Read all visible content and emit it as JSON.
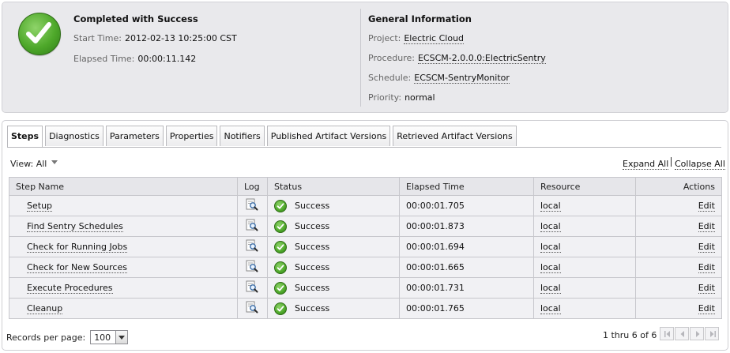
{
  "summary": {
    "status_title": "Completed with Success",
    "start_time_label": "Start Time:",
    "start_time": "2012-02-13 10:25:00 CST",
    "elapsed_label": "Elapsed Time:",
    "elapsed": "00:00:11.142"
  },
  "general": {
    "title": "General Information",
    "project_label": "Project:",
    "project": "Electric Cloud",
    "procedure_label": "Procedure:",
    "procedure": "ECSCM-2.0.0.0:ElectricSentry",
    "schedule_label": "Schedule:",
    "schedule": "ECSCM-SentryMonitor",
    "priority_label": "Priority:",
    "priority": "normal"
  },
  "tabs": [
    {
      "label": "Steps",
      "active": true
    },
    {
      "label": "Diagnostics"
    },
    {
      "label": "Parameters"
    },
    {
      "label": "Properties"
    },
    {
      "label": "Notifiers"
    },
    {
      "label": "Published Artifact Versions"
    },
    {
      "label": "Retrieved Artifact Versions"
    }
  ],
  "view": {
    "label": "View:",
    "value": "All"
  },
  "expand_all": "Expand All",
  "collapse_all": "Collapse All",
  "table": {
    "headers": [
      "Step Name",
      "Log",
      "Status",
      "Elapsed Time",
      "Resource",
      "Actions"
    ],
    "rows": [
      {
        "step": "Setup",
        "status": "Success",
        "elapsed": "00:00:01.705",
        "resource": "local",
        "action": "Edit"
      },
      {
        "step": "Find Sentry Schedules",
        "status": "Success",
        "elapsed": "00:00:01.873",
        "resource": "local",
        "action": "Edit"
      },
      {
        "step": "Check for Running Jobs",
        "status": "Success",
        "elapsed": "00:00:01.694",
        "resource": "local",
        "action": "Edit"
      },
      {
        "step": "Check for New Sources",
        "status": "Success",
        "elapsed": "00:00:01.665",
        "resource": "local",
        "action": "Edit"
      },
      {
        "step": "Execute Procedures",
        "status": "Success",
        "elapsed": "00:00:01.731",
        "resource": "local",
        "action": "Edit"
      },
      {
        "step": "Cleanup",
        "status": "Success",
        "elapsed": "00:00:01.765",
        "resource": "local",
        "action": "Edit"
      }
    ]
  },
  "footer": {
    "records_label": "Records per page:",
    "records_value": "100",
    "range": "1 thru 6 of 6"
  },
  "icons": {
    "status": "check-circle-icon",
    "log": "magnifier-log-icon",
    "pager": [
      "first-page-icon",
      "prev-page-icon",
      "next-page-icon",
      "last-page-icon"
    ]
  },
  "colors": {
    "success": "#4ea82a"
  }
}
